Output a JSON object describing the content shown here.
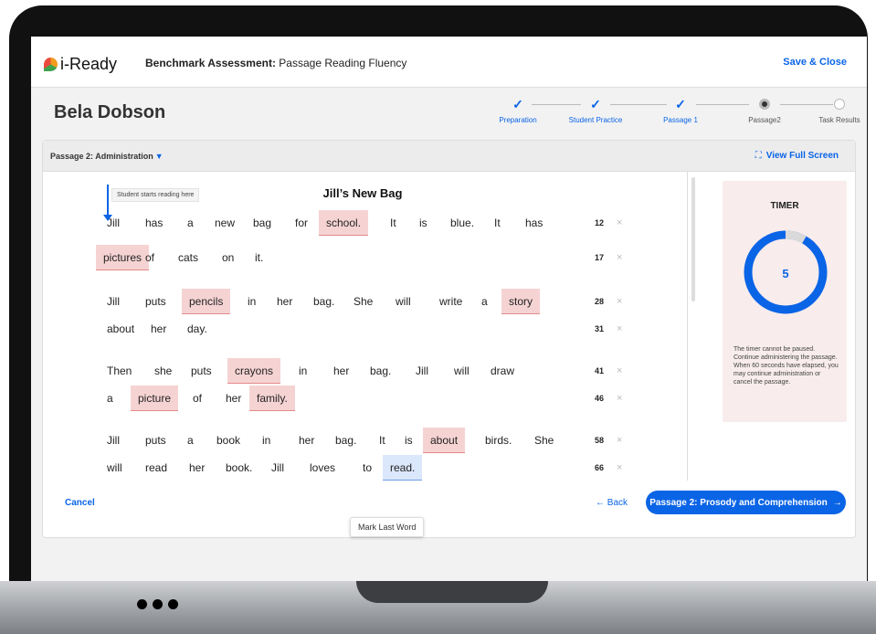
{
  "app": {
    "logo": "i-Ready",
    "title_bold": "Benchmark Assessment:",
    "title_rest": "Passage Reading Fluency",
    "save_close": "Save & Close"
  },
  "student": {
    "name": "Bela Dobson"
  },
  "steps": [
    {
      "label": "Preparation",
      "state": "done"
    },
    {
      "label": "Student Practice",
      "state": "done"
    },
    {
      "label": "Passage 1",
      "state": "done"
    },
    {
      "label": "Passage2",
      "state": "current"
    },
    {
      "label": "Task Results",
      "state": "todo"
    }
  ],
  "panel": {
    "admin_label": "Passage 2: Administration",
    "full_screen": "View Full Screen",
    "full_screen_icon": "expand-icon"
  },
  "passage": {
    "start_label": "Student starts reading here",
    "title": "Jill’s New Bag",
    "lines": [
      {
        "words": [
          {
            "t": "Jill"
          },
          {
            "t": "has"
          },
          {
            "t": "a"
          },
          {
            "t": "new"
          },
          {
            "t": "bag"
          },
          {
            "t": "for"
          },
          {
            "t": "school.",
            "err": true
          },
          {
            "t": "It"
          },
          {
            "t": "is"
          },
          {
            "t": "blue."
          },
          {
            "t": "It"
          },
          {
            "t": "has"
          }
        ],
        "count": "12"
      },
      {
        "words": [
          {
            "t": "pictures",
            "err": true
          },
          {
            "t": "of"
          },
          {
            "t": "cats"
          },
          {
            "t": "on"
          },
          {
            "t": "it."
          }
        ],
        "count": "17"
      },
      {
        "words": [
          {
            "t": "Jill"
          },
          {
            "t": "puts"
          },
          {
            "t": "pencils",
            "err": true
          },
          {
            "t": "in"
          },
          {
            "t": "her"
          },
          {
            "t": "bag."
          },
          {
            "t": "She"
          },
          {
            "t": "will"
          },
          {
            "t": "write"
          },
          {
            "t": "a"
          },
          {
            "t": "story",
            "err": true
          }
        ],
        "count": "28"
      },
      {
        "words": [
          {
            "t": "about"
          },
          {
            "t": "her"
          },
          {
            "t": "day."
          }
        ],
        "count": "31"
      },
      {
        "words": [
          {
            "t": "Then"
          },
          {
            "t": "she"
          },
          {
            "t": "puts"
          },
          {
            "t": "crayons",
            "err": true
          },
          {
            "t": "in"
          },
          {
            "t": "her"
          },
          {
            "t": "bag."
          },
          {
            "t": "Jill"
          },
          {
            "t": "will"
          },
          {
            "t": "draw"
          }
        ],
        "count": "41"
      },
      {
        "words": [
          {
            "t": "a"
          },
          {
            "t": "picture",
            "err": true
          },
          {
            "t": "of"
          },
          {
            "t": "her"
          },
          {
            "t": "family.",
            "err": true
          }
        ],
        "count": "46"
      },
      {
        "words": [
          {
            "t": "Jill"
          },
          {
            "t": "puts"
          },
          {
            "t": "a"
          },
          {
            "t": "book"
          },
          {
            "t": "in"
          },
          {
            "t": "her"
          },
          {
            "t": "bag."
          },
          {
            "t": "It"
          },
          {
            "t": "is"
          },
          {
            "t": "about",
            "err": true
          },
          {
            "t": "birds."
          },
          {
            "t": "She"
          }
        ],
        "count": "58"
      },
      {
        "words": [
          {
            "t": "will"
          },
          {
            "t": "read"
          },
          {
            "t": "her"
          },
          {
            "t": "book."
          },
          {
            "t": "Jill"
          },
          {
            "t": "loves"
          },
          {
            "t": "to"
          },
          {
            "t": "read.",
            "last": true
          }
        ],
        "count": "66"
      }
    ],
    "tooltip": "Mark Last Word"
  },
  "timer": {
    "title": "TIMER",
    "value": "5",
    "progress": 0.083,
    "note": "The timer cannot be paused. Continue administering the passage. When 60 seconds have elapsed, you may continue administration or cancel the passage."
  },
  "footer": {
    "cancel": "Cancel",
    "back": "← Back",
    "next": "Passage 2: Prosody and Comprehension",
    "next_arrow": "→"
  },
  "colors": {
    "accent": "#0a64e6",
    "error_highlight": "#f6d3d3",
    "last_word_highlight": "#dbe7fb"
  }
}
